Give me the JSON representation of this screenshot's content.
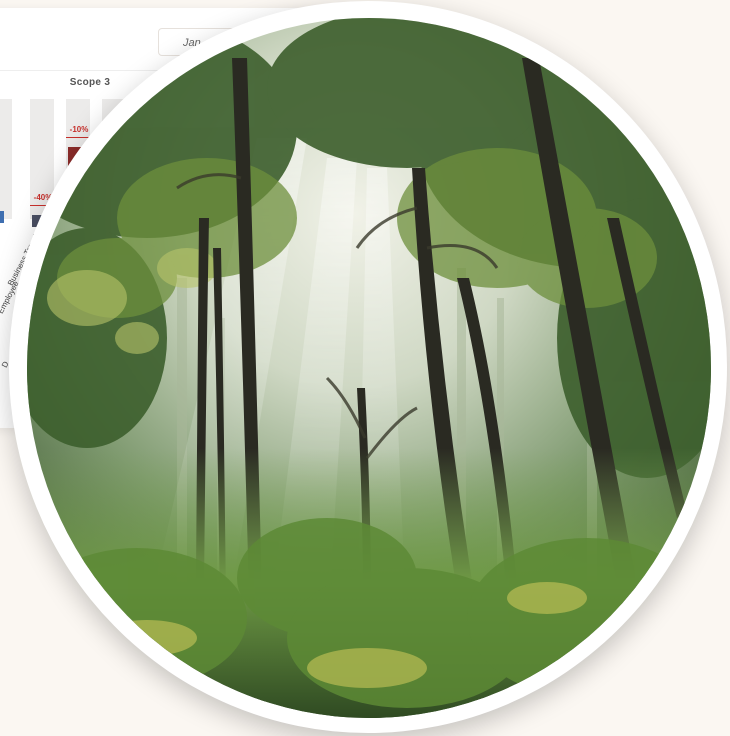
{
  "dashboard": {
    "date_prefix": "Jan",
    "scope_title": "Scope 3",
    "bars": [
      {
        "label": "-40%",
        "category": "Business Travel",
        "value": -40
      },
      {
        "label": "-10%",
        "category": "Employee",
        "value": -10
      }
    ],
    "fragment_letter": "D"
  },
  "photo": {
    "subject": "forest-trees-sunlight"
  },
  "colors": {
    "background": "#fbf7f2",
    "bar_dark_red": "#8c2c2a",
    "bar_navy": "#4a4f63",
    "label_red": "#c8302c"
  }
}
